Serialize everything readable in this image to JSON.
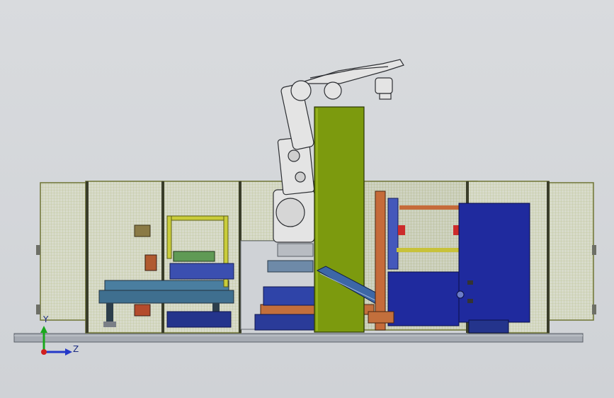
{
  "viewport": {
    "background": "#d6d8db"
  },
  "triad": {
    "y_label": "Y",
    "z_label": "Z",
    "y_color": "#18a81b",
    "z_color": "#2438c8",
    "origin_color": "#d11f1f"
  },
  "model": {
    "fence_color": "#c6cf7c",
    "robot_color": "#e4e4e4",
    "column_color": "#7c9a0e",
    "cabinet_color": "#1f2a9e",
    "conveyor_color": "#4a7ea0",
    "platform_color": "#9aa0a8"
  }
}
